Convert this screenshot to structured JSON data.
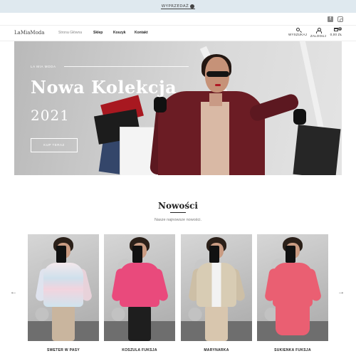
{
  "promo": {
    "label": "WYPRZEDAŻ"
  },
  "social": {
    "facebook_icon": "facebook-icon",
    "instagram_icon": "instagram-icon"
  },
  "nav": {
    "logo": "LaMiaModa",
    "links": [
      {
        "label": "Strona Główna",
        "active": false
      },
      {
        "label": "Sklep",
        "active": true
      },
      {
        "label": "Koszyk",
        "active": true
      },
      {
        "label": "Kontakt",
        "active": true
      }
    ],
    "actions": {
      "search_label": "WYSZUKAJ",
      "login_label": "ZALOGUJ",
      "cart_label": "0,00 ZŁ",
      "cart_count": "0"
    }
  },
  "hero": {
    "kicker": "LA MIA MODA",
    "title": "Nowa Kolekcja",
    "year": "2021",
    "button_label": "KUP TERAZ"
  },
  "new_products": {
    "title": "Nowości",
    "subtitle": "Nasze najnowsze nowości.",
    "products": [
      {
        "name": "SWETER W PASY"
      },
      {
        "name": "KOSZULA FUKSJA"
      },
      {
        "name": "MARYNARKA"
      },
      {
        "name": "SUKIENKA FUKSJA"
      }
    ]
  },
  "colors": {
    "promo_bg": "#dfe9ef",
    "coat": "#6b1c24",
    "fuchsia": "#e94a7c"
  }
}
